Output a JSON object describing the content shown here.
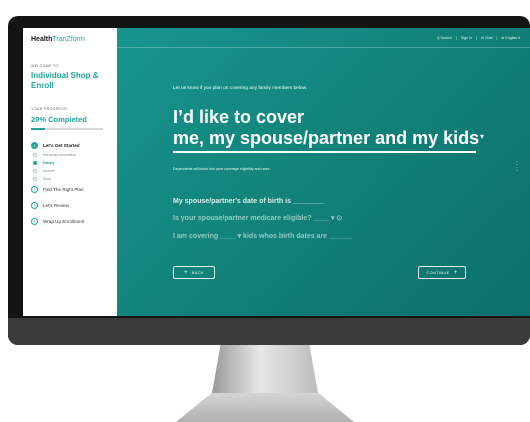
{
  "brand": {
    "name_bold": "Health",
    "name_light": "TranZform"
  },
  "topnav": {
    "search": "Q Search",
    "sign_in": "Sign In",
    "chat": "✉ Chat",
    "language": "⊕ English ▾"
  },
  "sidebar": {
    "welcome_label": "WELCOME TO:",
    "title": "Individual Shop & Enroll",
    "progress_label": "YOUR PROGRESS:",
    "progress_text": "20% Completed",
    "progress_fraction": 0.2,
    "steps": [
      {
        "num": "1",
        "label": "Let's Get Started",
        "state": "active",
        "substeps": [
          {
            "label": "Personal Information",
            "current": false
          },
          {
            "label": "Family",
            "current": true
          },
          {
            "label": "Income",
            "current": false
          },
          {
            "label": "Shop",
            "current": false
          }
        ]
      },
      {
        "num": "2",
        "label": "Find The Right Plan",
        "state": "upcoming"
      },
      {
        "num": "3",
        "label": "Let's Review",
        "state": "upcoming"
      },
      {
        "num": "4",
        "label": "Wrap Up Enrollment",
        "state": "upcoming"
      }
    ]
  },
  "main": {
    "intro": "Let us know if you plan on covering any family members below.",
    "headline_line1": "I’d like to cover",
    "headline_line2": "me, my spouse/partner and my kids",
    "note": "Dependents will factor into your coverage eligibility and rates.",
    "question1": "My spouse/partner's date of birth is ________",
    "question2": "Is your spouse/partner medicare eligible? ____ ▾  ⊙",
    "question3": "I am covering ____ ▾ kids whos birth dates are ______",
    "back_label": "BACK",
    "continue_label": "CONTINUE"
  },
  "colors": {
    "brand": "#1fa39a",
    "main_bg": "#118077"
  }
}
